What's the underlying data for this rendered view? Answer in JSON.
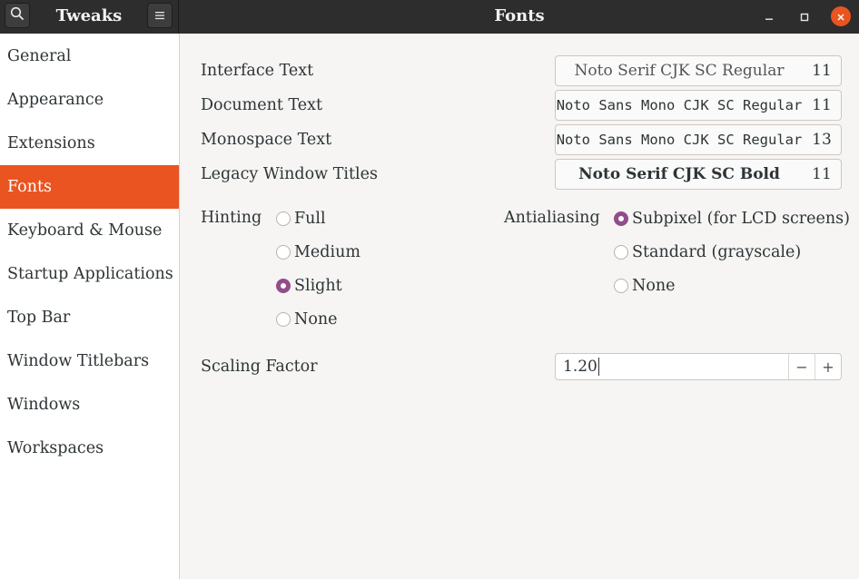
{
  "titlebar": {
    "app_title": "Tweaks",
    "page_title": "Fonts"
  },
  "sidebar": {
    "items": [
      {
        "label": "General"
      },
      {
        "label": "Appearance"
      },
      {
        "label": "Extensions"
      },
      {
        "label": "Fonts",
        "active": true
      },
      {
        "label": "Keyboard & Mouse"
      },
      {
        "label": "Startup Applications"
      },
      {
        "label": "Top Bar"
      },
      {
        "label": "Window Titlebars"
      },
      {
        "label": "Windows"
      },
      {
        "label": "Workspaces"
      }
    ]
  },
  "fonts": {
    "interface": {
      "label": "Interface Text",
      "font": "Noto Serif CJK SC Regular",
      "size": "11"
    },
    "document": {
      "label": "Document Text",
      "font": "Noto Sans Mono CJK SC Regular",
      "size": "11"
    },
    "monospace": {
      "label": "Monospace Text",
      "font": "Noto Sans Mono CJK SC Regular",
      "size": "13"
    },
    "legacy": {
      "label": "Legacy Window Titles",
      "font": "Noto Serif CJK SC Bold",
      "size": "11"
    }
  },
  "hinting": {
    "label": "Hinting",
    "options": [
      "Full",
      "Medium",
      "Slight",
      "None"
    ],
    "selected": "Slight"
  },
  "antialiasing": {
    "label": "Antialiasing",
    "options": [
      "Subpixel (for LCD screens)",
      "Standard (grayscale)",
      "None"
    ],
    "selected": "Subpixel (for LCD screens)"
  },
  "scaling": {
    "label": "Scaling Factor",
    "value": "1.20",
    "minus": "−",
    "plus": "+"
  },
  "colors": {
    "accent": "#e95420",
    "radio_selected": "#924d8b",
    "titlebar": "#2d2d2d"
  }
}
